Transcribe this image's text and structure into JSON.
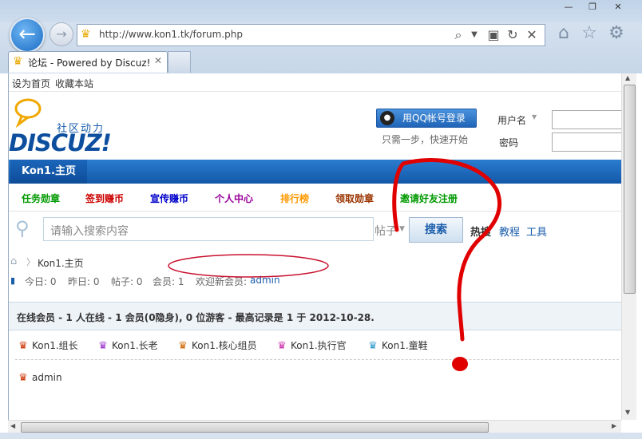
{
  "browser": {
    "url": "http://www.kon1.tk/forum.php",
    "tab_title": "论坛 - Powered by Discuz!",
    "tab_close": "✕",
    "back_glyph": "←",
    "fwd_glyph": "→",
    "window_buttons": [
      "—",
      "❐",
      "✕"
    ],
    "icons": [
      "home-icon",
      "star-icon",
      "gear-icon"
    ]
  },
  "topbar": {
    "set_home": "设为首页",
    "bookmark": "收藏本站"
  },
  "logo": {
    "slogan": "社区动力",
    "brand": "DISCUZ!"
  },
  "login": {
    "qq_button": "用QQ帐号登录",
    "qq_hint": "只需一步，快速开始",
    "username_label": "用户名",
    "password_label": "密码"
  },
  "nav": {
    "home": "Kon1.主页"
  },
  "subnav": [
    {
      "label": "任务勋章",
      "color": "#009900"
    },
    {
      "label": "签到赚币",
      "color": "#cc0000"
    },
    {
      "label": "宣传赚币",
      "color": "#0000cc"
    },
    {
      "label": "个人中心",
      "color": "#990099"
    },
    {
      "label": "排行榜",
      "color": "#ff9900"
    },
    {
      "label": "领取勋章",
      "color": "#993300"
    },
    {
      "label": "邀请好友注册",
      "color": "#009900"
    }
  ],
  "search": {
    "placeholder": "请输入搜索内容",
    "type": "帖子",
    "button": "搜索",
    "hot": "热搜",
    "tutorial": "教程",
    "tools": "工具"
  },
  "breadcrumb": {
    "home": "Kon1.主页"
  },
  "stats": {
    "today": "今日: 0",
    "yesterday": "昨日: 0",
    "posts": "帖子: 0",
    "members": "会员: 1",
    "welcome": "欢迎新会员:",
    "newest": "admin"
  },
  "online": {
    "title": "在线会员 - 1 人在线 - 1 会员(0隐身), 0 位游客 - 最高记录是 1 于 2012-10-28.",
    "groups": [
      {
        "label": "Kon1.组长",
        "color": "#cc3300"
      },
      {
        "label": "Kon1.长老",
        "color": "#9933cc"
      },
      {
        "label": "Kon1.核心组员",
        "color": "#cc6600"
      },
      {
        "label": "Kon1.执行官",
        "color": "#cc33aa"
      },
      {
        "label": "Kon1.童鞋",
        "color": "#3399cc"
      }
    ],
    "members": [
      "admin"
    ]
  },
  "annotation": {
    "color": "#e00000",
    "mark": "?"
  }
}
